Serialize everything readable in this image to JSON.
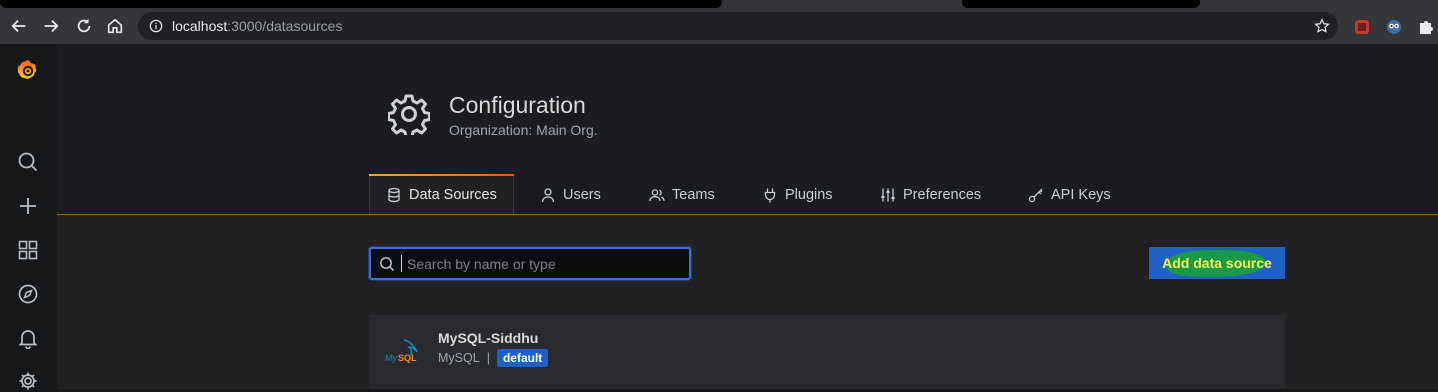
{
  "browser": {
    "url_host": "localhost",
    "url_rest": ":3000/datasources"
  },
  "header": {
    "title": "Configuration",
    "subtitle": "Organization: Main Org."
  },
  "tabs": [
    {
      "label": "Data Sources",
      "icon": "database-icon",
      "active": true
    },
    {
      "label": "Users",
      "icon": "user-icon",
      "active": false
    },
    {
      "label": "Teams",
      "icon": "users-icon",
      "active": false
    },
    {
      "label": "Plugins",
      "icon": "plug-icon",
      "active": false
    },
    {
      "label": "Preferences",
      "icon": "sliders-icon",
      "active": false
    },
    {
      "label": "API Keys",
      "icon": "key-icon",
      "active": false
    }
  ],
  "search": {
    "placeholder": "Search by name or type",
    "value": ""
  },
  "actions": {
    "add_label": "Add data source"
  },
  "datasources": [
    {
      "name": "MySQL-Siddhu",
      "type": "MySQL",
      "separator": "|",
      "badge": "default",
      "logo": "mysql-logo"
    }
  ],
  "sidebar": {
    "icons": [
      "grafana-logo",
      "search-icon",
      "plus-icon",
      "dashboards-icon",
      "explore-icon",
      "alerting-icon",
      "gear-icon"
    ]
  },
  "colors": {
    "accent": "#1f60c4",
    "tab_highlight": "#eb5b19"
  }
}
